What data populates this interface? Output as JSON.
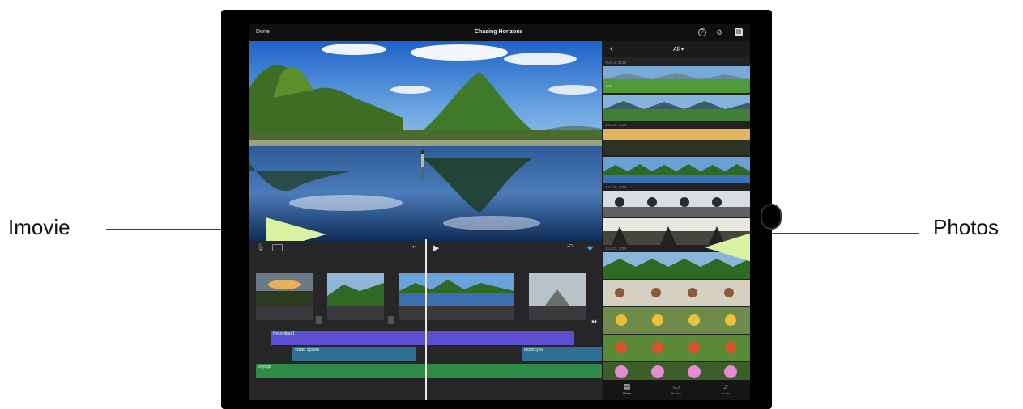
{
  "annotations": {
    "left_label": "Imovie",
    "right_label": "Photos"
  },
  "app": {
    "done_label": "Done",
    "project_title": "Chasing Horizons",
    "help_icon": "question-circle-icon",
    "settings_icon": "gear-icon",
    "share_icon": "media-library-icon"
  },
  "browser": {
    "back_icon": "chevron-left-icon",
    "filter_label": "All ▾",
    "groups": [
      {
        "date": "AUG 2, 2015",
        "badge": "0.7s"
      },
      {
        "date": "JUL 29, 2015"
      },
      {
        "date": "JUL 28, 2015"
      },
      {
        "date": "JUL 27, 2015"
      }
    ],
    "tabs": [
      {
        "label": "Video",
        "icon": "film-icon"
      },
      {
        "label": "Photos",
        "icon": "photo-icon"
      },
      {
        "label": "Audio",
        "icon": "music-note-icon"
      }
    ]
  },
  "timeline": {
    "skip_back_icon": "skip-to-start-icon",
    "play_icon": "▶",
    "undo_icon": "↶",
    "audio_tracks": [
      {
        "label": "Recording 1",
        "color": "#5b4fd0"
      },
      {
        "label": "Water Splash",
        "color": "#2f6f93"
      },
      {
        "label": "Motorcycle",
        "color": "#2f6f93"
      },
      {
        "label": "Voyage",
        "color": "#2e8a45"
      }
    ]
  },
  "colors": {
    "callout_arrow": "#d9f3a3",
    "callout_line": "#1f5a2e",
    "accent": "#2fa7e6"
  }
}
